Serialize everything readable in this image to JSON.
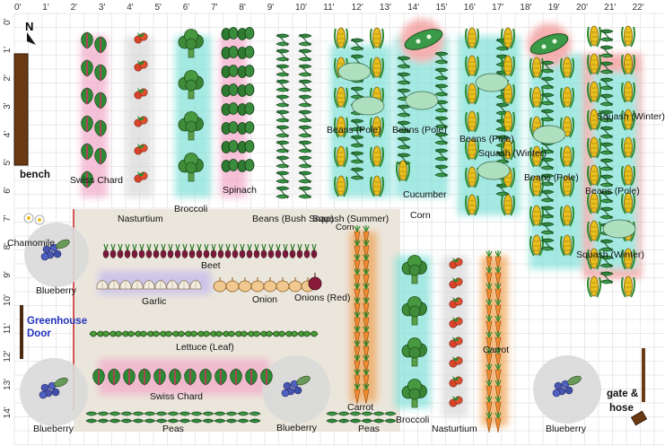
{
  "plan": {
    "compass": "N",
    "feet_x": [
      "0'",
      "1'",
      "2'",
      "3'",
      "4'",
      "5'",
      "6'",
      "7'",
      "8'",
      "9'",
      "10'",
      "11'",
      "12'",
      "13'",
      "14'",
      "15'",
      "16'",
      "17'",
      "18'",
      "19'",
      "20'",
      "21'",
      "22'"
    ],
    "feet_y": [
      "0'",
      "1'",
      "2'",
      "3'",
      "4'",
      "5'",
      "6'",
      "7'",
      "8'",
      "9'",
      "10'",
      "11'",
      "12'",
      "13'",
      "14'"
    ]
  },
  "labels": {
    "bench": "bench",
    "swiss_chard_top": "Swiss Chard",
    "broccoli_top": "Broccoli",
    "spinach": "Spinach",
    "nasturtium_top": "Nasturtium",
    "beans_bush": "Beans (Bush Snap)",
    "squash_summer": "Squash (Summer)",
    "corn_small": "Corn",
    "corn_mid": "Corn",
    "cucumber": "Cucumber",
    "beans_pole_1": "Beans (Pole)",
    "beans_pole_2": "Beans (Pole)",
    "beans_pole_3": "Beans (Pole)",
    "beans_pole_4": "Beans (Pole)",
    "beans_pole_5": "Beans (Pole)",
    "squash_winter_1": "Squash (Winter)",
    "squash_winter_2": "Squash (Winter)",
    "squash_winter_3": "Squash (Winter)",
    "chamomile": "Chamomile",
    "beet": "Beet",
    "garlic": "Garlic",
    "onion": "Onion",
    "onion_red": "Onions (Red)",
    "blueberry_1": "Blueberry",
    "blueberry_2": "Blueberry",
    "blueberry_3": "Blueberry",
    "blueberry_4": "Blueberry",
    "greenhouse_door": "Greenhouse Door",
    "lettuce": "Lettuce (Leaf)",
    "carrot_1": "Carrot",
    "carrot_2": "Carrot",
    "swiss_chard_bottom": "Swiss Chard",
    "peas_1": "Peas",
    "peas_2": "Peas",
    "broccoli_bottom": "Broccoli",
    "nasturtium_bottom": "Nasturtium",
    "gate_hose": "gate & hose"
  },
  "colors": {
    "grid": "#d4d4d4",
    "bed": "#ebe6dc",
    "bench": "#6b3a12",
    "greenhouse_line": "#cc2222",
    "blueberry": "#4a55b0",
    "carrot": "#f0a050",
    "corn": "#e8c020",
    "bean": "#2e8a3e",
    "tomato": "#d8442a",
    "halo_cyan": "#7fe0d8",
    "halo_pink": "#f2a8c8",
    "halo_red": "#f29090"
  }
}
